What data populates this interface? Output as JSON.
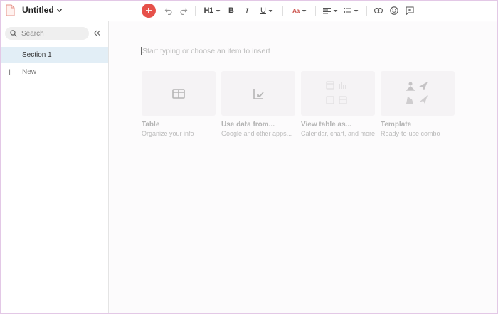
{
  "header": {
    "title": "Untitled",
    "toolbar": {
      "heading_label": "H1",
      "bold_label": "B",
      "italic_label": "I",
      "underline_label": "U",
      "font_label": "Aa"
    }
  },
  "sidebar": {
    "search_placeholder": "Search",
    "items": [
      {
        "label": "Section 1",
        "selected": true
      }
    ],
    "new_label": "New"
  },
  "main": {
    "placeholder": "Start typing or choose an item to insert",
    "cards": [
      {
        "title": "Table",
        "subtitle": "Organize your info",
        "icon": "table-icon"
      },
      {
        "title": "Use data from...",
        "subtitle": "Google and other apps...",
        "icon": "import-data-icon"
      },
      {
        "title": "View table as...",
        "subtitle": "Calendar, chart, and more",
        "icon": "view-as-icon"
      },
      {
        "title": "Template",
        "subtitle": "Ready-to-use combo",
        "icon": "template-icon"
      }
    ]
  },
  "colors": {
    "accent": "#e6514a",
    "selected_bg": "#e2eef6",
    "frame_border": "#e3c8e6"
  }
}
